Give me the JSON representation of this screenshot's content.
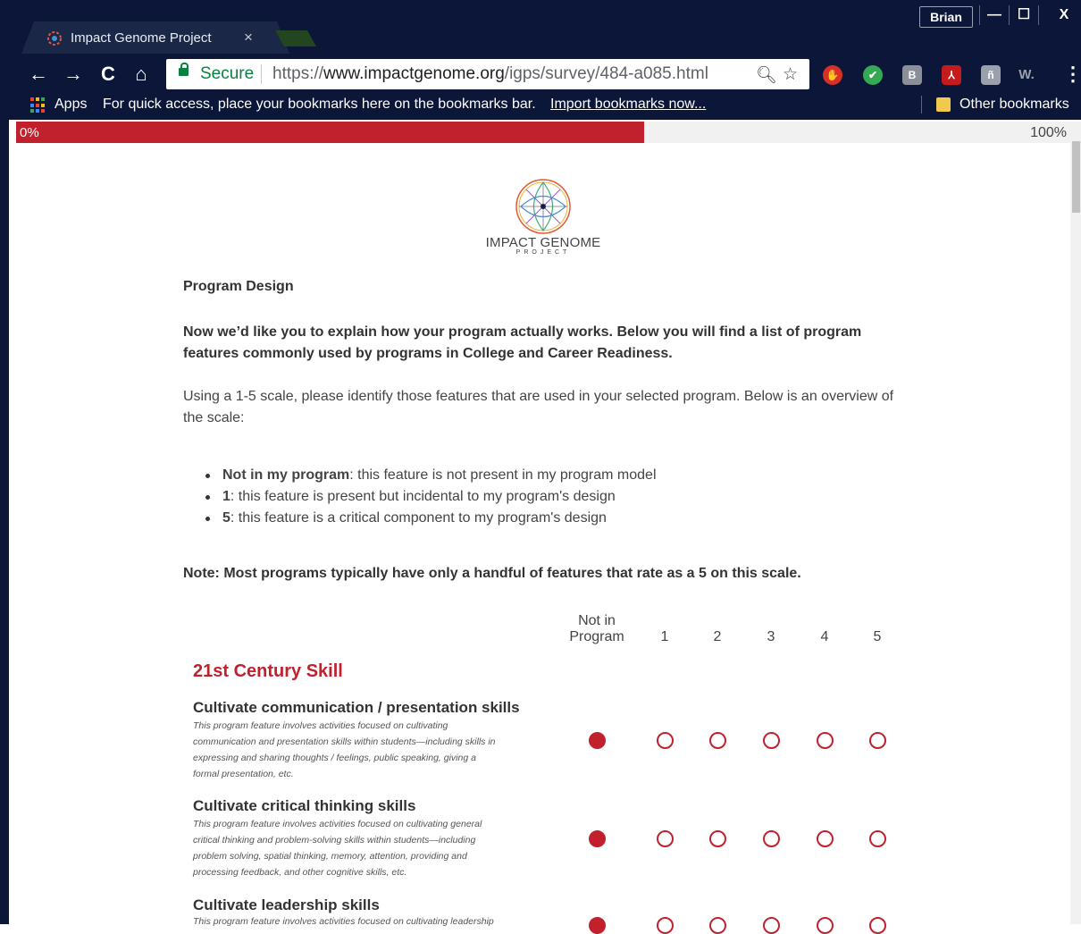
{
  "browser": {
    "tab_title": "Impact Genome Project",
    "tab_close": "×",
    "user_name": "Brian",
    "window_controls": {
      "minimize": "—",
      "maximize": "☐",
      "close": "X"
    },
    "nav": {
      "back": "←",
      "forward": "→",
      "reload": "C",
      "home": "⌂"
    },
    "secure_label": "Secure",
    "url_scheme": "https://",
    "url_host": "www.impactgenome.org",
    "url_path": "/igps/survey/484-a085.html",
    "extensions": [
      "adblock-icon",
      "check-icon",
      "reader-icon",
      "pdf-icon",
      "extension-icon",
      "w-icon"
    ],
    "ext_w_label": "W.",
    "menu": "⋮"
  },
  "bookmarks_bar": {
    "apps_label": "Apps",
    "hint": "For quick access, place your bookmarks here on the bookmarks bar.",
    "import_link": "Import bookmarks now...",
    "other_label": "Other bookmarks"
  },
  "progress": {
    "start_label": "0%",
    "end_label": "100%",
    "fraction": 0.59
  },
  "logo": {
    "name": "IMPACT GENOME",
    "sub": "PROJECT"
  },
  "survey": {
    "section_title": "Program Design",
    "lead": "Now we’d like you to explain how your program actually works. Below you will find a list of program features commonly used by programs in College and Career Readiness.",
    "intro": "Using a 1-5 scale, please identify those features that are used in your selected program. Below is an overview of the scale:",
    "scale_items": [
      {
        "term": "Not in my program",
        "rest": ": this feature is not present in my program model"
      },
      {
        "term": "1",
        "rest": ": this feature is present but incidental to my program's design"
      },
      {
        "term": "5",
        "rest": ": this feature is a critical component to my program's design"
      }
    ],
    "note": "Note: Most programs typically have only a handful of features that rate as a 5 on this scale.",
    "columns": {
      "not_line1": "Not in",
      "not_line2": "Program",
      "c1": "1",
      "c2": "2",
      "c3": "3",
      "c4": "4",
      "c5": "5"
    },
    "category": "21st Century Skill",
    "features": [
      {
        "title": "Cultivate communication / presentation skills",
        "desc_lines": [
          "This program feature involves activities focused on cultivating",
          "communication and presentation skills within students—including skills in",
          "expressing and sharing thoughts / feelings, public speaking, giving a",
          "formal presentation, etc."
        ],
        "selected": "Not in Program"
      },
      {
        "title": "Cultivate critical thinking skills",
        "desc_lines": [
          "This program feature involves activities focused on cultivating general",
          "critical thinking and problem-solving skills within students—including",
          "problem solving, spatial thinking, memory, attention, providing and",
          "processing feedback, and other cognitive skills, etc."
        ],
        "selected": "Not in Program"
      },
      {
        "title": "Cultivate leadership skills",
        "desc_lines": [
          "This program feature involves activities focused on cultivating leadership"
        ],
        "selected": "Not in Program"
      }
    ]
  },
  "colors": {
    "accent": "#c0212d",
    "chrome": "#0b1638",
    "secure": "#0b8043"
  }
}
